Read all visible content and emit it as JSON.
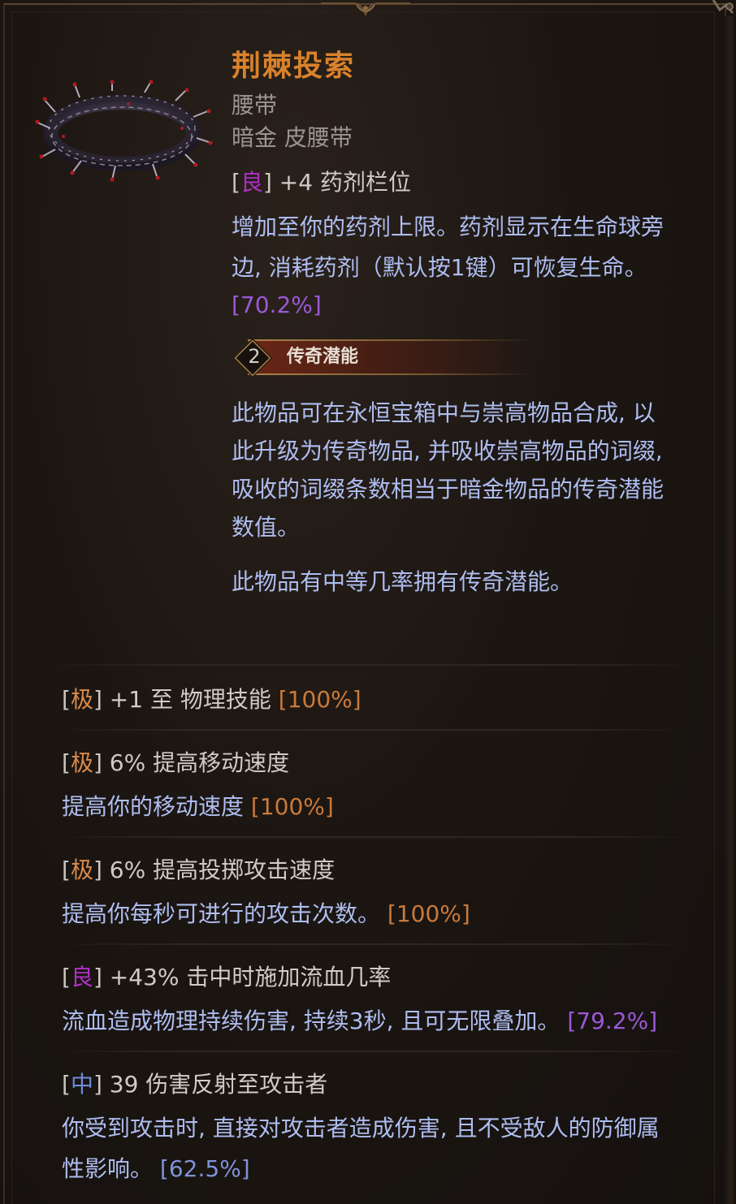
{
  "item": {
    "name": "荆棘投索",
    "type": "腰带",
    "rarity": "暗金",
    "base": "皮腰带",
    "name_color": "#d9822b"
  },
  "implicit": {
    "tier": "良",
    "text": "+4 药剂栏位",
    "desc_lines": [
      "增加至你的药剂上限。药剂显示在生命球旁",
      "边, 消耗药剂（默认按1键）可恢复生命。"
    ],
    "pct": "[70.2%]"
  },
  "legendary": {
    "potential": "2",
    "label": "传奇潜能",
    "para1": [
      "此物品可在永恒宝箱中与崇高物品合成, 以",
      "此升级为传奇物品, 并吸收崇高物品的词缀,",
      "吸收的词缀条数相当于暗金物品的传奇潜能",
      "数值。"
    ],
    "para2": "此物品有中等几率拥有传奇潜能。"
  },
  "affixes": [
    {
      "tier": "极",
      "text": "+1 至 物理技能",
      "pct": "[100%]",
      "desc": ""
    },
    {
      "tier": "极",
      "text": "6% 提高移动速度",
      "desc": "提高你的移动速度",
      "pct": "[100%]"
    },
    {
      "tier": "极",
      "text": "6% 提高投掷攻击速度",
      "desc": "提高你每秒可进行的攻击次数。",
      "pct": "[100%]"
    },
    {
      "tier": "良",
      "text": "+43% 击中时施加流血几率",
      "desc": "流血造成物理持续伤害, 持续3秒, 且可无限叠加。",
      "pct": "[79.2%]"
    },
    {
      "tier": "中",
      "text": "39 伤害反射至攻击者",
      "desc_lines": [
        "你受到攻击时, 直接对攻击者造成伤害, 且不受敌人的防御属",
        "性影响。"
      ],
      "pct": "[62.5%]"
    }
  ]
}
